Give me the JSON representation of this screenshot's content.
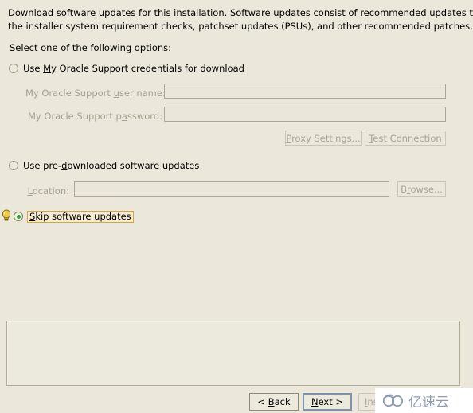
{
  "header": {
    "line1": "Download software updates for this installation. Software updates consist of recommended updates to",
    "line2": "the installer system requirement checks, patchset updates (PSUs), and other recommended patches."
  },
  "prompt": "Select one of the following options:",
  "options": [
    {
      "id": "use-my-oracle-support",
      "label_before": "Use ",
      "label_mnemonic": "M",
      "label_after": "y Oracle Support credentials for download",
      "full_label": "Use My Oracle Support credentials for download",
      "selected": false
    },
    {
      "id": "use-pre-downloaded",
      "label_before": "Use pre-",
      "label_mnemonic": "d",
      "label_after": "ownloaded software updates",
      "full_label": "Use pre-downloaded software updates",
      "selected": false
    },
    {
      "id": "skip-software-updates",
      "label_before": "",
      "label_mnemonic": "S",
      "label_after": "kip software updates",
      "full_label": "Skip software updates",
      "selected": true,
      "focused": true
    }
  ],
  "fields": {
    "username": {
      "label_before": "My Oracle Support ",
      "label_mnemonic": "u",
      "label_after": "ser name:",
      "full_label": "My Oracle Support user name:",
      "value": "",
      "placeholder": "",
      "disabled": true
    },
    "password": {
      "label_before": "My Oracle Support p",
      "label_mnemonic": "a",
      "label_after": "ssword:",
      "full_label": "My Oracle Support password:",
      "value": "",
      "placeholder": "",
      "disabled": true
    },
    "location": {
      "label_before": "",
      "label_mnemonic": "L",
      "label_after": "ocation:",
      "full_label": "Location:",
      "value": "",
      "placeholder": "",
      "disabled": true
    }
  },
  "buttons": {
    "proxy_settings": {
      "label_before": "",
      "label_mnemonic": "P",
      "label_after": "roxy Settings...",
      "full_label": "Proxy Settings...",
      "disabled": true
    },
    "test_connection": {
      "label_before": "",
      "label_mnemonic": "T",
      "label_after": "est Connection",
      "full_label": "Test Connection",
      "disabled": true
    },
    "browse": {
      "label_before": "B",
      "label_mnemonic": "r",
      "label_after": "owse...",
      "full_label": "Browse...",
      "disabled": true
    },
    "back": {
      "label_before": "< ",
      "label_mnemonic": "B",
      "label_after": "ack",
      "full_label": "< Back",
      "disabled": false
    },
    "next": {
      "label_before": "",
      "label_mnemonic": "N",
      "label_after": "ext >",
      "full_label": "Next >",
      "disabled": false,
      "is_default": true
    },
    "install": {
      "label_before": "",
      "label_mnemonic": "I",
      "label_after": "nst",
      "full_label": "Install",
      "disabled": true
    }
  },
  "message_panel": {
    "text": ""
  },
  "watermark": {
    "text": "亿速云",
    "icon": "cloud-logo-icon"
  },
  "colors": {
    "background": "#ebe7da",
    "radio_selected": "#3a9c3a",
    "focus_outline": "#d8a43c",
    "default_button_border": "#7b93ad",
    "disabled_text": "#a6a290",
    "watermark_text": "#8f9bb3"
  }
}
